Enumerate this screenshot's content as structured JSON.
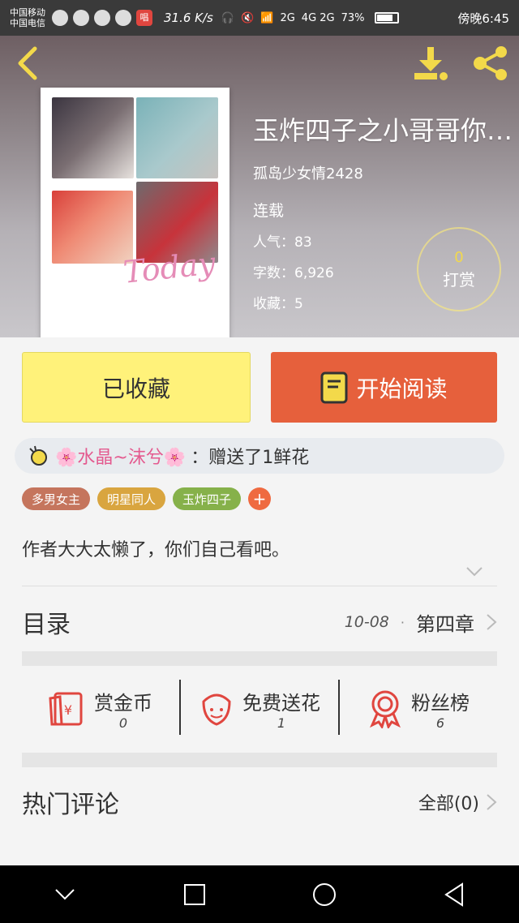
{
  "status_bar": {
    "carrier_1": "中国移动",
    "carrier_2": "中国电信",
    "notification_badge": "唱",
    "speed": "31.6 K/s",
    "network_1": "2G",
    "network_2": "4G 2G",
    "battery_percent": "73%",
    "battery_level": 0.73,
    "time": "傍晚6:45"
  },
  "header": {
    "book_title": "玉炸四子之小哥哥你是一",
    "author": "孤岛少女情2428",
    "status": "连载",
    "popularity": "人气：83",
    "word_count": "字数：6,926",
    "favorites": "收藏：5",
    "cover_script": "Today",
    "reward": {
      "count": "0",
      "label": "打赏"
    }
  },
  "actions": {
    "collected_label": "已收藏",
    "read_label": "开始阅读"
  },
  "gift": {
    "sender": "🌸水晶~沫兮🌸",
    "message": "：赠送了1鲜花"
  },
  "tags": [
    "多男女主",
    "明星同人",
    "玉炸四子"
  ],
  "tag_add": "+",
  "summary": "作者大大太懒了，你们自己看吧。",
  "toc": {
    "title": "目录",
    "date": "10-08",
    "dot": "·",
    "latest_chapter": "第四章"
  },
  "support": [
    {
      "label": "赏金币",
      "count": "0",
      "icon": "red-envelope-icon"
    },
    {
      "label": "免费送花",
      "count": "1",
      "icon": "flower-icon"
    },
    {
      "label": "粉丝榜",
      "count": "6",
      "icon": "medal-icon"
    }
  ],
  "comments": {
    "title": "热门评论",
    "all_label": "全部(0)"
  },
  "colors": {
    "accent_orange": "#e6603c",
    "collected_yellow": "#fff27a",
    "icon_yellow": "#f3d94a",
    "icon_red": "#e0463f"
  }
}
